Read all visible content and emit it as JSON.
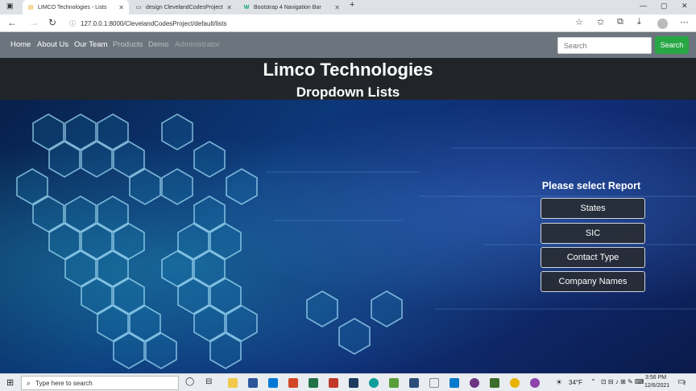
{
  "browser": {
    "tabs": [
      {
        "label": "LIMCO Technologies - Lists",
        "active": true,
        "icon": "page-icon"
      },
      {
        "label": "design ClevelandCodesProject",
        "active": false,
        "icon": "document-icon"
      },
      {
        "label": "Bootstrap 4 Navigation Bar",
        "active": false,
        "icon": "w3-icon"
      }
    ],
    "new_tab": "+",
    "url": "127.0.0.1:8000/ClevelandCodesProject/default/lists"
  },
  "nav": {
    "links": [
      {
        "label": "Home",
        "state": "active"
      },
      {
        "label": "About Us",
        "state": "active"
      },
      {
        "label": "Our Team",
        "state": "active"
      },
      {
        "label": "Products",
        "state": "muted"
      },
      {
        "label": "Demo",
        "state": "muted"
      },
      {
        "label": "Administrator",
        "state": "disabled"
      }
    ],
    "search_placeholder": "Search",
    "search_button": "Search"
  },
  "header": {
    "title": "Limco Technologies",
    "subtitle": "Dropdown Lists"
  },
  "report": {
    "heading": "Please select Report",
    "buttons": [
      "States",
      "SIC",
      "Contact Type",
      "Company Names"
    ]
  },
  "taskbar": {
    "search_placeholder": "Type here to search",
    "temperature": "34°F",
    "time": "3:56 PM",
    "date": "12/6/2021",
    "notifications": "2"
  },
  "colors": {
    "navbar": "#6c757d",
    "header": "#212529",
    "search_button": "#28a745",
    "report_button": "#282c34"
  }
}
